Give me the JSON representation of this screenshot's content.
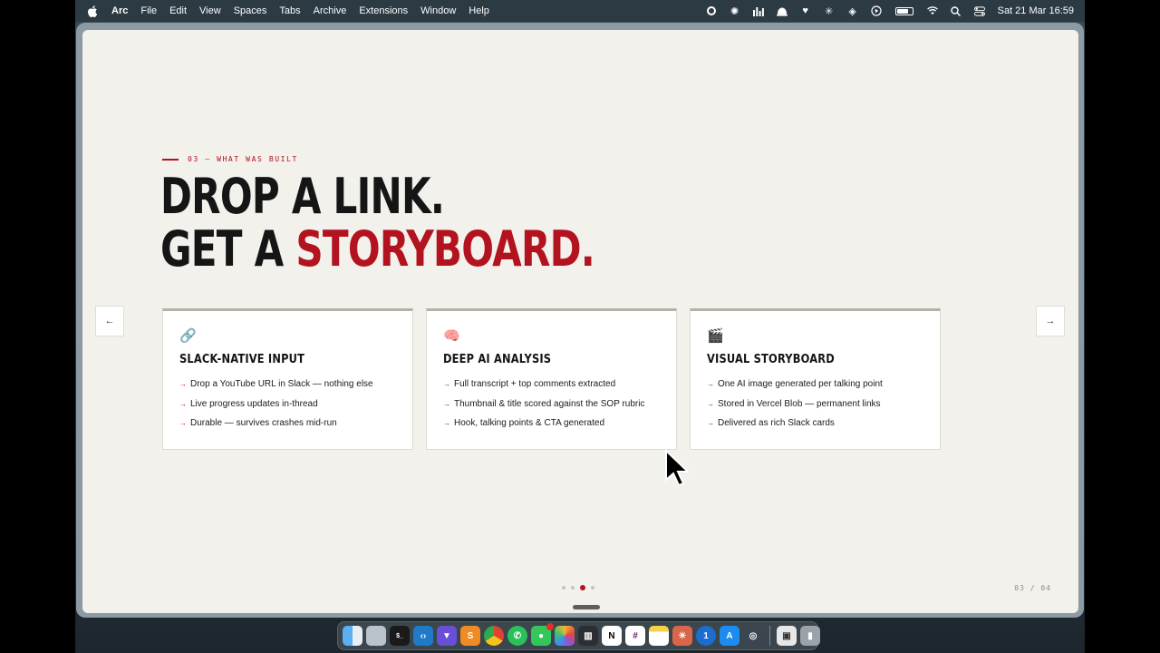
{
  "menubar": {
    "apple_icon": "apple-icon",
    "items": [
      "Arc",
      "File",
      "Edit",
      "View",
      "Spaces",
      "Tabs",
      "Archive",
      "Extensions",
      "Window",
      "Help"
    ],
    "status_icons": [
      "record-icon",
      "sun-icon",
      "chart-icon",
      "bell-icon",
      "heart-check-icon",
      "sparkle-icon",
      "layers-icon",
      "play-icon",
      "battery-icon",
      "wifi-icon",
      "search-icon",
      "control-center-icon"
    ],
    "clock": "Sat 21 Mar  16:59"
  },
  "slide": {
    "eyebrow": "03 — WHAT WAS BUILT",
    "headline_line1": "DROP A LINK.",
    "headline_line2_prefix": "GET A ",
    "headline_line2_accent": "STORYBOARD.",
    "prev_label": "←",
    "next_label": "→",
    "cards": [
      {
        "icon": "🔗",
        "icon_name": "link-icon",
        "title": "SLACK-NATIVE INPUT",
        "items": [
          "Drop a YouTube URL in Slack — nothing else",
          "Live progress updates in-thread",
          "Durable — survives crashes mid-run"
        ]
      },
      {
        "icon": "🧠",
        "icon_name": "brain-icon",
        "title": "DEEP AI ANALYSIS",
        "items": [
          "Full transcript + top comments extracted",
          "Thumbnail & title scored against the SOP rubric",
          "Hook, talking points & CTA generated"
        ]
      },
      {
        "icon": "🎬",
        "icon_name": "clapperboard-icon",
        "title": "VISUAL STORYBOARD",
        "items": [
          "One AI image generated per talking point",
          "Stored in Vercel Blob — permanent links",
          "Delivered as rich Slack cards"
        ]
      }
    ],
    "bullet_marker": "→",
    "page_indicator": "03 / 04",
    "dots_total": 4,
    "dots_active_index": 2
  },
  "dock": {
    "apps": [
      "finder",
      "files",
      "terminal",
      "vscode",
      "vpn",
      "sublime",
      "chrome",
      "whatsapp",
      "messages",
      "photos",
      "stats",
      "notion",
      "slack",
      "notes",
      "claude",
      "onepassword",
      "appstore",
      "screenshot",
      "preview",
      "trash"
    ]
  },
  "colors": {
    "accent": "#b3121f",
    "page_bg": "#f3f1ec"
  }
}
